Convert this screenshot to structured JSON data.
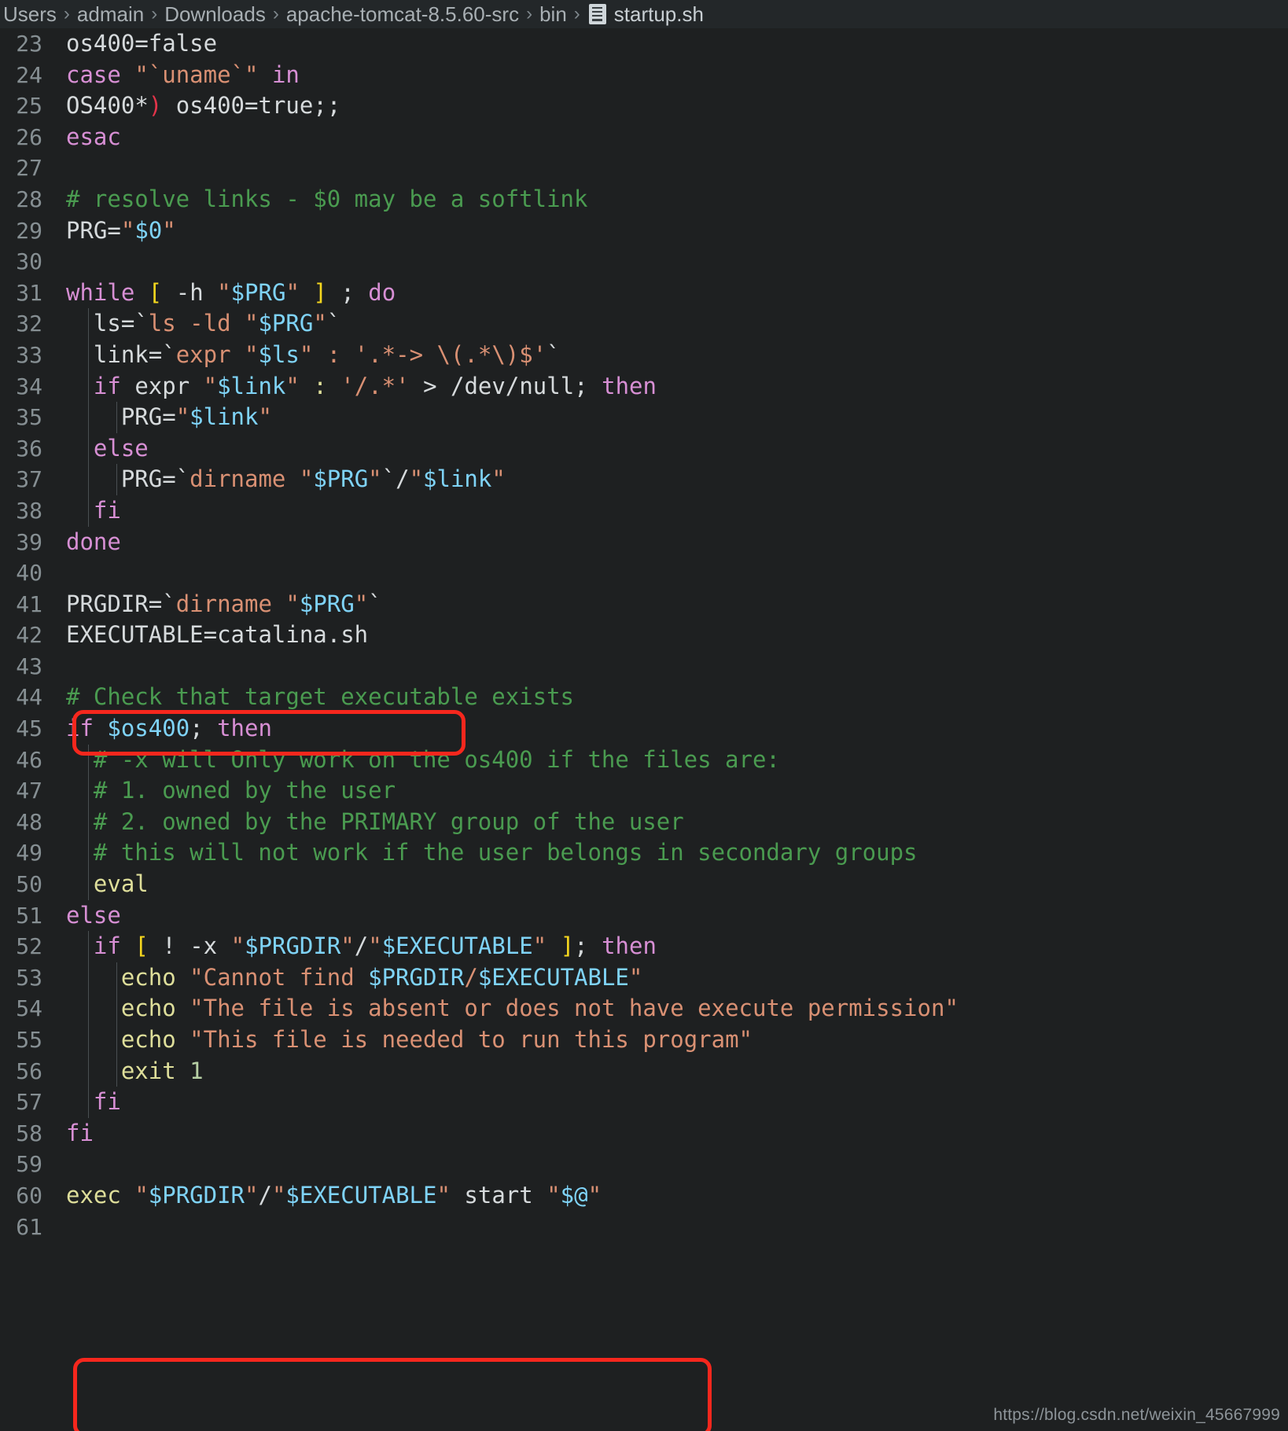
{
  "breadcrumb": {
    "items": [
      "Users",
      "admain",
      "Downloads",
      "apache-tomcat-8.5.60-src",
      "bin"
    ],
    "separator": "›",
    "file_icon": "file-icon",
    "file": "startup.sh"
  },
  "editor": {
    "first_line_number": 23,
    "language": "shellscript",
    "theme_background": "#1e2021",
    "colors": {
      "keyword": "#d78fd4",
      "comment": "#4a9b50",
      "string": "#d99073",
      "variable": "#7fd3f7",
      "builtin": "#dede9a",
      "plain": "#d6dadc",
      "line_number": "#868f93",
      "bracket_yellow": "#f5d71e",
      "bracket_red": "#e3344a",
      "annotation": "#f6271d"
    },
    "lines": [
      {
        "n": 23,
        "text": "os400=false"
      },
      {
        "n": 24,
        "text": "case \"`uname`\" in"
      },
      {
        "n": 25,
        "text": "OS400*) os400=true;;"
      },
      {
        "n": 26,
        "text": "esac"
      },
      {
        "n": 27,
        "text": ""
      },
      {
        "n": 28,
        "text": "# resolve links - $0 may be a softlink"
      },
      {
        "n": 29,
        "text": "PRG=\"$0\""
      },
      {
        "n": 30,
        "text": ""
      },
      {
        "n": 31,
        "text": "while [ -h \"$PRG\" ] ; do"
      },
      {
        "n": 32,
        "text": "  ls=`ls -ld \"$PRG\"`"
      },
      {
        "n": 33,
        "text": "  link=`expr \"$ls\" : '.*-> \\(.*\\)$'`"
      },
      {
        "n": 34,
        "text": "  if expr \"$link\" : '/.*' > /dev/null; then"
      },
      {
        "n": 35,
        "text": "    PRG=\"$link\""
      },
      {
        "n": 36,
        "text": "  else"
      },
      {
        "n": 37,
        "text": "    PRG=`dirname \"$PRG\"`/\"$link\""
      },
      {
        "n": 38,
        "text": "  fi"
      },
      {
        "n": 39,
        "text": "done"
      },
      {
        "n": 40,
        "text": ""
      },
      {
        "n": 41,
        "text": "PRGDIR=`dirname \"$PRG\"`"
      },
      {
        "n": 42,
        "text": "EXECUTABLE=catalina.sh"
      },
      {
        "n": 43,
        "text": ""
      },
      {
        "n": 44,
        "text": "# Check that target executable exists"
      },
      {
        "n": 45,
        "text": "if $os400; then"
      },
      {
        "n": 46,
        "text": "  # -x will Only work on the os400 if the files are:"
      },
      {
        "n": 47,
        "text": "  # 1. owned by the user"
      },
      {
        "n": 48,
        "text": "  # 2. owned by the PRIMARY group of the user"
      },
      {
        "n": 49,
        "text": "  # this will not work if the user belongs in secondary groups"
      },
      {
        "n": 50,
        "text": "  eval"
      },
      {
        "n": 51,
        "text": "else"
      },
      {
        "n": 52,
        "text": "  if [ ! -x \"$PRGDIR\"/\"$EXECUTABLE\" ]; then"
      },
      {
        "n": 53,
        "text": "    echo \"Cannot find $PRGDIR/$EXECUTABLE\""
      },
      {
        "n": 54,
        "text": "    echo \"The file is absent or does not have execute permission\""
      },
      {
        "n": 55,
        "text": "    echo \"This file is needed to run this program\""
      },
      {
        "n": 56,
        "text": "    exit 1"
      },
      {
        "n": 57,
        "text": "  fi"
      },
      {
        "n": 58,
        "text": "fi"
      },
      {
        "n": 59,
        "text": ""
      },
      {
        "n": 60,
        "text": "exec \"$PRGDIR\"/\"$EXECUTABLE\" start \"$@\""
      },
      {
        "n": 61,
        "text": ""
      }
    ]
  },
  "annotations": [
    {
      "name": "executable-assignment-highlight",
      "line": 42,
      "color": "#f6271d"
    },
    {
      "name": "exec-command-highlight",
      "line": 60,
      "color": "#f6271d"
    }
  ],
  "watermark": {
    "text": "https://blog.csdn.net/weixin_45667999"
  }
}
